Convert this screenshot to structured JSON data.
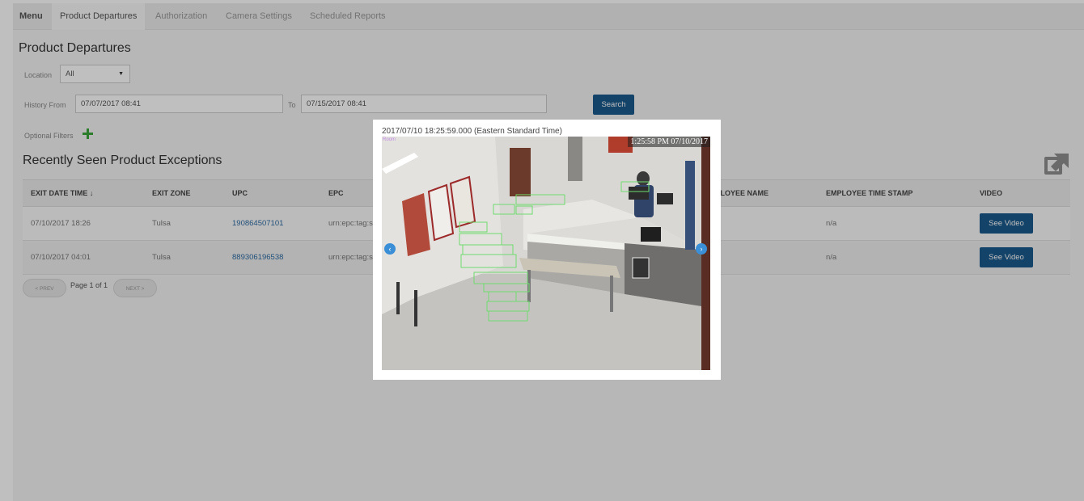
{
  "navbar": {
    "brand": "Menu",
    "items": [
      "Product Departures",
      "Authorization",
      "Camera Settings",
      "Scheduled Reports"
    ]
  },
  "page": {
    "title": "Product Departures",
    "location_label": "Location",
    "location_value": "All",
    "history_from_label": "History From",
    "history_from_value": "07/07/2017 08:41",
    "to_label": "To",
    "to_value": "07/15/2017 08:41",
    "search_button": "Search",
    "optional_filters": "Optional Filters"
  },
  "exceptions": {
    "title": "Recently Seen Product Exceptions",
    "columns": [
      "EXIT DATE TIME",
      "EXIT ZONE",
      "UPC",
      "EPC",
      "EMPLOYEE NAME",
      "EMPLOYEE TIME STAMP",
      "VIDEO"
    ],
    "sort_indicator": "↓",
    "rows": [
      {
        "exit_date_time": "07/10/2017 18:26",
        "exit_zone": "Tulsa",
        "upc": "190864507101",
        "epc": "urn:epc:tag:s",
        "employee_time_stamp": "n/a",
        "video": "See Video"
      },
      {
        "exit_date_time": "07/10/2017 04:01",
        "exit_zone": "Tulsa",
        "upc": "889306196538",
        "epc": "urn:epc:tag:s",
        "employee_time_stamp": "n/a",
        "video": "See Video"
      }
    ]
  },
  "pager": {
    "prev": "< PREV",
    "text": "Page 1 of 1",
    "next": "NEXT >"
  },
  "modal": {
    "timestamp": "2017/07/10 18:25:59.000 (Eastern Standard Time)",
    "camera_overlay": "1:25:58 PM 07/10/2017",
    "camera_tag": "Room"
  },
  "colors": {
    "primary": "#1b5a8c",
    "link": "#2d6ba3",
    "plus": "#3aa63a",
    "motion_box": "#6fdc6f"
  }
}
